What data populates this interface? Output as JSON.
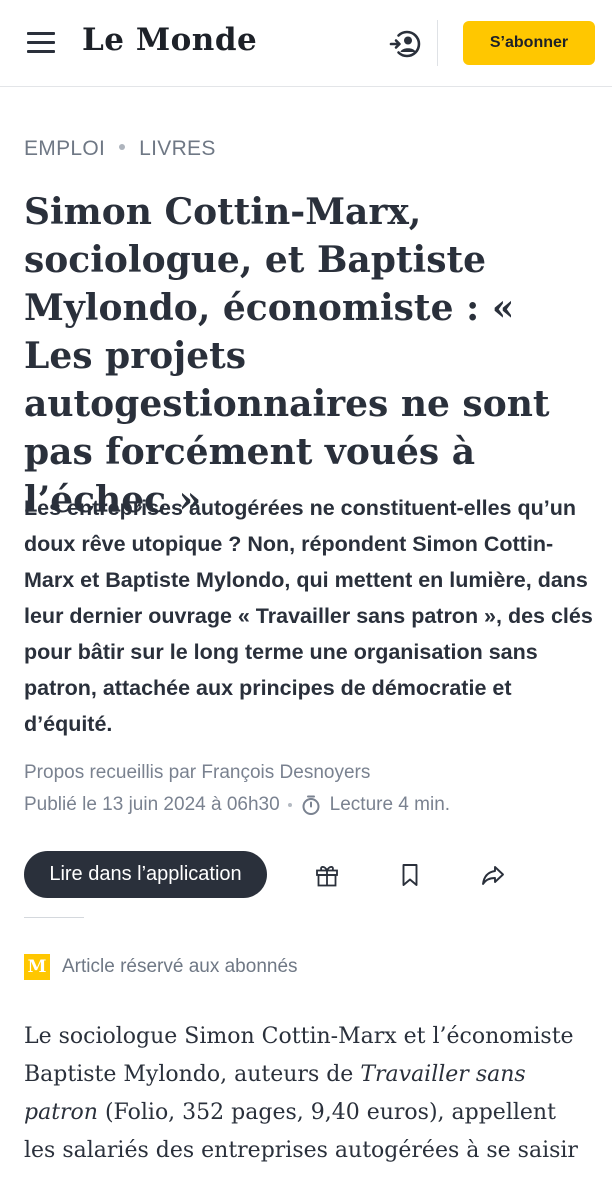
{
  "header": {
    "menu_icon": "hamburger-menu-icon",
    "logo_text": "Le Monde",
    "account_icon": "account-login-icon",
    "subscribe_label": "S’abonner",
    "accent_color": "#ffc700"
  },
  "article": {
    "kicker": [
      "EMPLOI",
      "LIVRES"
    ],
    "title": "Simon Cottin-Marx, sociologue, et Baptiste Mylondo, économiste : « Les projets autogestionnaires ne sont pas forcément voués à l’échec »",
    "lede": "Les entreprises autogérées ne constituent-elles qu’un doux rêve utopique ? Non, répondent Simon Cottin-Marx et Baptiste Mylondo, qui mettent en lumière, dans leur dernier ouvrage « Travailler sans patron », des clés pour bâtir sur le long terme une organisation sans patron, attachée aux principes de démocratie et d’équité.",
    "byline": "Propos recueillis par François Desnoyers",
    "published": "Publié le 13 juin 2024 à 06h30",
    "reading_time": "Lecture 4 min.",
    "read_in_app_label": "Lire dans l’application",
    "actions": [
      "gift-icon",
      "bookmark-icon",
      "share-icon"
    ],
    "premium_badge": "M",
    "premium_label": "Article réservé aux abonnés",
    "body": {
      "part1": "Le sociologue Simon Cottin-Marx et l’économiste Baptiste Mylondo, auteurs de ",
      "book_title": "Travailler sans patron",
      "part2": " (Folio, 352 pages, 9,40 euros), appellent les salariés des entreprises autogérées à se saisir"
    }
  }
}
